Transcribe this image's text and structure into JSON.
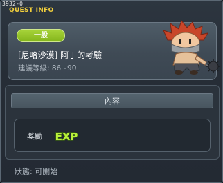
{
  "quest_id": "3932-0",
  "window_title": "QUEST INFO",
  "category_badge": "一般",
  "quest_name": "[尼哈沙漠] 阿丁的考驗",
  "recommended_level": "建議等級: 86~90",
  "section_title": "內容",
  "reward_label": "獎勵",
  "reward_icon_text": "EXP",
  "status": "狀態: 可開始",
  "colors": {
    "title": "#f2cf3c",
    "badge": "#94c42a",
    "exp": "#b9f03a"
  }
}
